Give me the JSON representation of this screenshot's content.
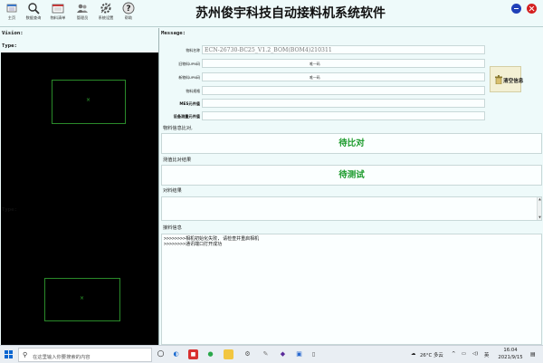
{
  "app": {
    "title": "苏州俊宇科技自动接料机系统软件"
  },
  "toolbar": {
    "buttons": [
      {
        "label": "主页",
        "icon": "home-icon"
      },
      {
        "label": "数据查询",
        "icon": "search-icon"
      },
      {
        "label": "物料清单",
        "icon": "material-list-icon"
      },
      {
        "label": "管理员",
        "icon": "admin-icon"
      },
      {
        "label": "系统设置",
        "icon": "settings-icon"
      },
      {
        "label": "帮助",
        "icon": "help-icon"
      }
    ]
  },
  "left": {
    "vision_label": "Vision:",
    "type_label_top": "Type:",
    "type_label_bottom": "Type:"
  },
  "message": {
    "header": "Message:",
    "fields": {
      "material_name_label": "物料名称",
      "material_name_value": "ECN-26730-BC25_V1.2_BOM(BOM4)210311",
      "old_upn_label": "旧物料UPN码",
      "new_upn_label": "新物料UPN码",
      "only_code_label": "唯一码",
      "spec_label": "物料规格",
      "mes_value_label": "MES元件值",
      "device_value_label": "设备测量元件值"
    },
    "clear_button": "清空信息",
    "compare_section_label": "物料信息比对,",
    "compare_status": "待比对",
    "measure_section_label": "测值比对结果",
    "measure_status": "待测试",
    "result_section_label": "对料结果",
    "log_section_label": "接料信息",
    "log_lines": [
      ">>>>>>>>相机初始化失败, 请检查并重启相机",
      ">>>>>>>>通讯端口打开成功"
    ]
  },
  "colors": {
    "status_green": "#1a9a2a",
    "camera_bg": "#000000",
    "roi_green": "#2a8a2a",
    "window_minimize": "#2040b8",
    "window_close": "#d42020"
  },
  "taskbar": {
    "search_placeholder": "在这里输入你要搜索的内容",
    "weather": "26°C 多云",
    "input_method": "英",
    "time": "16:04",
    "date": "2021/9/15",
    "apps": [
      "task-view-icon",
      "edge-icon",
      "red-app-icon",
      "wechat-icon",
      "file-explorer-icon",
      "folder-icon",
      "settings-icon",
      "tools-icon",
      "vs-icon",
      "app-icon"
    ]
  }
}
